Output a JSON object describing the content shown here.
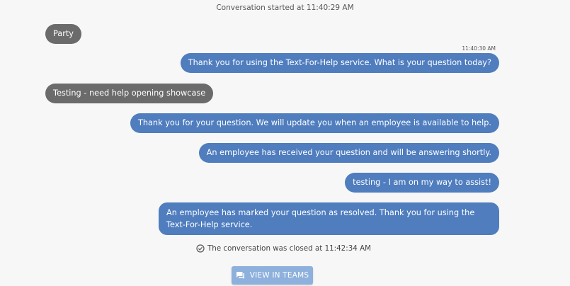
{
  "conversation": {
    "started_label": "Conversation started at 11:40:29 AM",
    "first_time": "11:40:30 AM",
    "messages": [
      {
        "from": "user",
        "text": "Party"
      },
      {
        "from": "service",
        "text": "Thank you for using the Text-For-Help service. What is your question today?"
      },
      {
        "from": "user",
        "text": "Testing - need help opening showcase"
      },
      {
        "from": "service",
        "text": "Thank you for your question. We will update you when an employee is available to help."
      },
      {
        "from": "service",
        "text": "An employee has received your question and will be answering shortly."
      },
      {
        "from": "service",
        "text": "testing - I am on my way to assist!"
      },
      {
        "from": "service",
        "text": "An employee has marked your question as resolved. Thank you for using the Text-For-Help service."
      }
    ],
    "closed_label": "The conversation was closed at 11:42:34 AM"
  },
  "actions": {
    "view_in_teams_label": "VIEW IN TEAMS"
  },
  "colors": {
    "incoming_bubble": "#6b6b6b",
    "outgoing_bubble": "#4f7dbe",
    "button": "#8eb0dc"
  },
  "icons": {
    "closed": "check-circle-icon",
    "teams": "chat-bubble-icon"
  }
}
